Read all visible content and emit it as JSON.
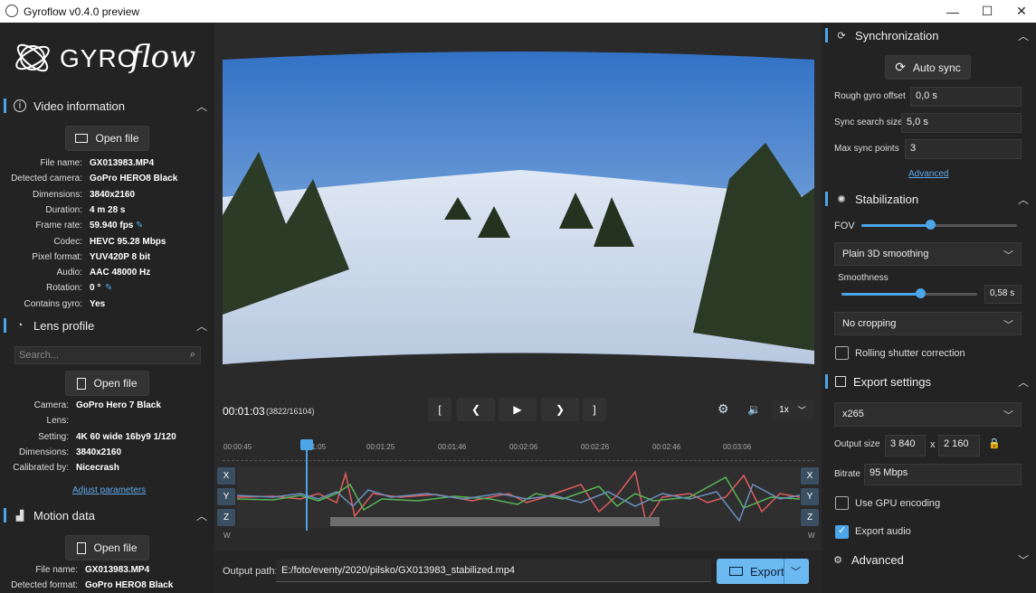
{
  "window": {
    "title": "Gyroflow v0.4.0 preview",
    "minimize": "—",
    "maximize": "☐",
    "close": "✕"
  },
  "logo": {
    "text": "GYRO",
    "script_text": "flow"
  },
  "video_info": {
    "header": "Video information",
    "open_file": "Open file",
    "rows": [
      {
        "k": "File name:",
        "v": "GX013983.MP4"
      },
      {
        "k": "Detected camera:",
        "v": "GoPro HERO8 Black"
      },
      {
        "k": "Dimensions:",
        "v": "3840x2160"
      },
      {
        "k": "Duration:",
        "v": "4 m 28 s"
      },
      {
        "k": "Frame rate:",
        "v": "59.940 fps"
      },
      {
        "k": "Codec:",
        "v": "HEVC 95.28 Mbps"
      },
      {
        "k": "Pixel format:",
        "v": "YUV420P 8 bit"
      },
      {
        "k": "Audio:",
        "v": "AAC 48000 Hz"
      },
      {
        "k": "Rotation:",
        "v": "0 °"
      },
      {
        "k": "Contains gyro:",
        "v": "Yes"
      }
    ]
  },
  "lens_profile": {
    "header": "Lens profile",
    "search_placeholder": "Search...",
    "open_file": "Open file",
    "rows": [
      {
        "k": "Camera:",
        "v": "GoPro Hero 7 Black"
      },
      {
        "k": "Lens:",
        "v": ""
      },
      {
        "k": "Setting:",
        "v": "4K 60 wide 16by9 1/120"
      },
      {
        "k": "Dimensions:",
        "v": "3840x2160"
      },
      {
        "k": "Calibrated by:",
        "v": "Nicecrash"
      }
    ],
    "adjust": "Adjust parameters"
  },
  "motion_data": {
    "header": "Motion data",
    "open_file": "Open file",
    "rows": [
      {
        "k": "File name:",
        "v": "GX013983.MP4"
      },
      {
        "k": "Detected format:",
        "v": "GoPro HERO8 Black"
      }
    ]
  },
  "player": {
    "time": "00:01:03",
    "frames": "(3822/16104)",
    "speed": "1x",
    "bracket_in": "[",
    "bracket_out": "]"
  },
  "timeline": {
    "ticks": [
      "00:00:45",
      "01:05",
      "00:01:25",
      "00:01:46",
      "00:02:06",
      "00:02:26",
      "00:02:46",
      "00:03:06"
    ],
    "axes": [
      "X",
      "Y",
      "Z"
    ],
    "w_left": "W",
    "w_right": "W",
    "playhead_fraction": 0.14
  },
  "output": {
    "label": "Output path:",
    "value": "E:/foto/eventy/2020/pilsko/GX013983_stabilized.mp4",
    "export": "Export"
  },
  "sync": {
    "header": "Synchronization",
    "auto_sync": "Auto sync",
    "fields": [
      {
        "label": "Rough gyro offset",
        "value": "0,0 s"
      },
      {
        "label": "Sync search size",
        "value": "5,0 s"
      },
      {
        "label": "Max sync points",
        "value": "3"
      }
    ],
    "advanced": "Advanced"
  },
  "stabilization": {
    "header": "Stabilization",
    "fov_label": "FOV",
    "fov_fraction": 0.44,
    "smoothing": "Plain 3D smoothing",
    "smoothness_label": "Smoothness",
    "smoothness_fraction": 0.58,
    "smoothness_value": "0,58 s",
    "cropping": "No cropping",
    "rolling_shutter": "Rolling shutter correction"
  },
  "export": {
    "header": "Export settings",
    "codec": "x265",
    "size_label": "Output size",
    "width": "3 840",
    "x": "x",
    "height": "2 160",
    "bitrate_label": "Bitrate",
    "bitrate": "95 Mbps",
    "gpu": "Use GPU encoding",
    "audio": "Export audio"
  },
  "advanced": {
    "header": "Advanced"
  },
  "colors": {
    "accent": "#4ca5e8",
    "bg": "#232323"
  }
}
